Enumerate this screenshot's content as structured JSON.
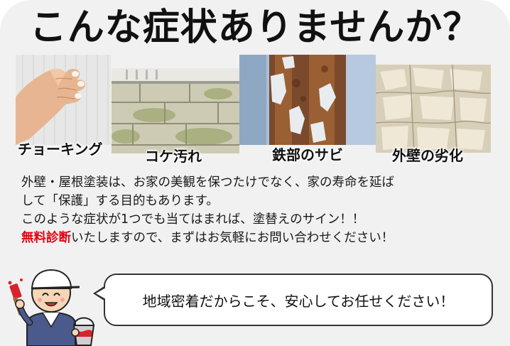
{
  "headline": "こんな症状ありませんか？",
  "symptoms": [
    {
      "label": "チョーキング"
    },
    {
      "label": "コケ汚れ"
    },
    {
      "label": "鉄部のサビ"
    },
    {
      "label": "外壁の劣化"
    }
  ],
  "body": {
    "line1": "外壁・屋根塗装は、お家の美観を保つたけでなく、家の寿命を延ば",
    "line2": "して「保護」する目的もあります。",
    "line3": "このような症状が1つでも当てはまれば、塗替えのサイン！！",
    "line4_highlight": "無料診断",
    "line4_rest": "いたしますので、まずはお気軽にお問い合わせください！"
  },
  "speech_bubble": "地域密着だからこそ、安心してお任せください！",
  "colors": {
    "accent_red": "#e60012",
    "background": "#f1f1f1"
  },
  "icons": [
    "painter-illustration",
    "paint-brush-icon",
    "paint-bucket-icon"
  ]
}
